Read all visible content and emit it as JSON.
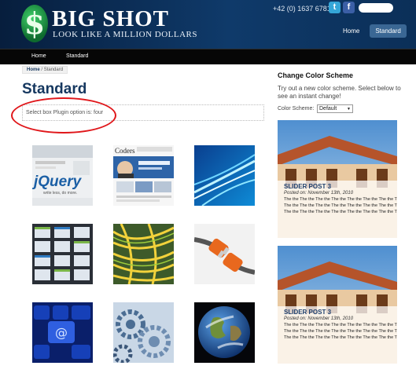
{
  "header": {
    "logo_symbol": "$",
    "site_title": "BIG SHOT",
    "tagline": "LOOK LIKE A MILLION DOLLARS",
    "phone": "+42 (0) 1637 678112",
    "social": {
      "twitter": "t",
      "facebook": "f"
    },
    "top_nav": [
      {
        "label": "Home"
      },
      {
        "label": "Standard",
        "active": true
      }
    ]
  },
  "menu": [
    {
      "label": "Home"
    },
    {
      "label": "Standard"
    }
  ],
  "breadcrumb": {
    "home": "Home",
    "sep": "/",
    "current": "Standard"
  },
  "page_title": "Standard",
  "plugin_note": "Select box Plugin option is: four",
  "sidebar": {
    "heading": "Change Color Scheme",
    "intro": "Try out a new color scheme. Select below to see an instant change!",
    "scheme_label": "Color Scheme:",
    "scheme_value": "Default",
    "slides": [
      {
        "title": "SLIDER POST 3",
        "date": "Posted on: November 13th, 2010",
        "lines": [
          "The the The the The the The the The the The the The the The",
          "The the The the The the The the The the The the The the The",
          "The the The the The the The the The the The the The the The"
        ]
      },
      {
        "title": "SLIDER POST 3",
        "date": "Posted on: November 13th, 2010",
        "lines": [
          "The the The the The the The the The the The the The the The",
          "The the The the The the The the The the The the The the The",
          "The the The the The the The the The the The the The the The"
        ]
      }
    ]
  },
  "thumbs": [
    {
      "name": "jquery-thumb",
      "caption": "jQuery",
      "sub": "write less, do more."
    },
    {
      "name": "coders-thumb",
      "caption": "Coders"
    },
    {
      "name": "light-streaks-thumb"
    },
    {
      "name": "calendar-thumb"
    },
    {
      "name": "cables-thumb"
    },
    {
      "name": "plugs-thumb"
    },
    {
      "name": "keyboard-thumb"
    },
    {
      "name": "gears-thumb"
    },
    {
      "name": "earth-thumb"
    }
  ]
}
